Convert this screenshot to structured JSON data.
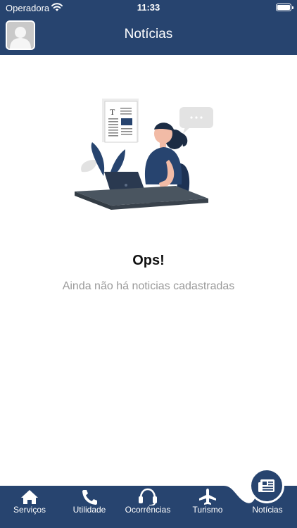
{
  "status": {
    "carrier": "Operadora",
    "time": "11:33"
  },
  "header": {
    "title": "Notícias"
  },
  "empty_state": {
    "title": "Ops!",
    "message": "Ainda não há noticias cadastradas"
  },
  "tabs": [
    {
      "label": "Serviços",
      "icon": "home-icon"
    },
    {
      "label": "Utilidade",
      "icon": "phone-icon"
    },
    {
      "label": "Ocorrências",
      "icon": "headset-icon"
    },
    {
      "label": "Turismo",
      "icon": "airplane-icon"
    },
    {
      "label": "Notícias",
      "icon": "newspaper-icon",
      "active": true
    }
  ],
  "colors": {
    "primary": "#27446f",
    "text_muted": "#9a9a9a"
  }
}
